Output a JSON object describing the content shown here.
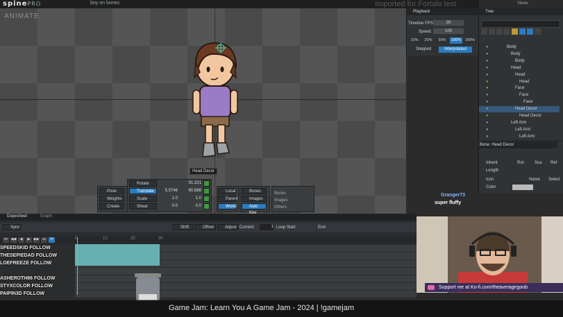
{
  "app": {
    "logo": "spine",
    "logo_suffix": "PRO",
    "file_title": "boy on bones",
    "banner": "Imported for Fortale test"
  },
  "viewport": {
    "mode_label": "ANIMATE",
    "bone_tooltip": "Head Decor"
  },
  "transform": {
    "rotate": {
      "label": "Rotate",
      "value": "91.321"
    },
    "translate": {
      "label": "Translate",
      "x": "5.5746",
      "y": "60.888"
    },
    "scale": {
      "label": "Scale",
      "x": "1.0",
      "y": "1.0"
    },
    "shear": {
      "label": "Shear",
      "x": "0.0",
      "y": "0.0"
    },
    "left_buttons": [
      "Pose",
      "Weights",
      "Create"
    ],
    "axes": [
      "Local",
      "Parent",
      "World"
    ],
    "toggles": [
      "Bones",
      "Images",
      "Auto Key"
    ],
    "comp_labels": [
      "Bones",
      "Images",
      "Others"
    ]
  },
  "playback": {
    "header": "Playback",
    "timeline_fps_label": "Timeline FPS:",
    "timeline_fps": "30",
    "speed_label": "Speed:",
    "speed": "100",
    "speed_presets": [
      "10%",
      "25%",
      "50%",
      "100%",
      "200%"
    ],
    "stepped": "Stepped",
    "interpolated": "Interpolated"
  },
  "tree": {
    "header": "Tree",
    "views_label": "Views",
    "rows": [
      {
        "label": "Body",
        "indent": 0
      },
      {
        "label": "Body",
        "indent": 1
      },
      {
        "label": "Body",
        "indent": 2
      },
      {
        "label": "Head",
        "indent": 1
      },
      {
        "label": "Head",
        "indent": 2
      },
      {
        "label": "Head",
        "indent": 3
      },
      {
        "label": "Face",
        "indent": 2
      },
      {
        "label": "Face",
        "indent": 3
      },
      {
        "label": "Face",
        "indent": 4
      },
      {
        "label": "Head Decor",
        "indent": 2,
        "selected": true
      },
      {
        "label": "Head Decor",
        "indent": 3
      },
      {
        "label": "Left Arm",
        "indent": 1
      },
      {
        "label": "Left Arm",
        "indent": 2
      },
      {
        "label": "Left Arm",
        "indent": 3
      }
    ]
  },
  "bone_panel": {
    "header": "Bone: Head Decor",
    "inherit_label": "Inherit",
    "inherit_opts": [
      "Rot",
      "Sca",
      "Ref"
    ],
    "length_label": "Length",
    "icon_label": "Icon",
    "name_label": "Name",
    "select_label": "Select",
    "color_label": "Color"
  },
  "dopesheet": {
    "tabs": [
      "Dopesheet",
      "Graph"
    ],
    "toolbar": [
      "Sync",
      "Shift",
      "Offset",
      "Adjust",
      "Current:",
      "Loop Start",
      "End"
    ],
    "current_frame": "1",
    "ticks": [
      "0",
      "10",
      "20",
      "30"
    ],
    "rows": [
      "SPEEDSKID FOLLOW",
      "THESEPIEDAD FOLLOW",
      "LOEFREEZE FOLLOW",
      "",
      "ASHEROTH86 FOLLOW",
      "STYXCOLOR FOLLOW",
      "PAIPIN3D FOLLOW"
    ]
  },
  "stream": {
    "chat_user": "Granger73",
    "chat_message": "super fluffy",
    "kofi": "Support me at Ko-fi.com/theaveragegoob",
    "title": "Game Jam: Learn You A Game Jam - 2024 | !gamejam"
  },
  "colors": {
    "accent": "#2b7bc0",
    "track": "#6ec4c8",
    "grid": "#4a4a4a"
  }
}
